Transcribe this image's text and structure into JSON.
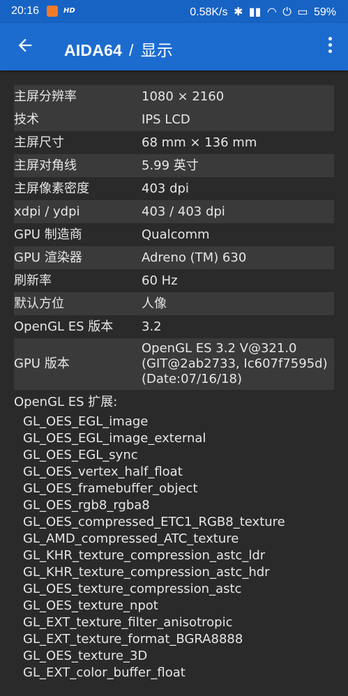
{
  "status": {
    "time": "20:16",
    "hd": "HD",
    "speed": "0.58K/s",
    "battery": "59%"
  },
  "toolbar": {
    "app": "AIDA64",
    "separator": "/",
    "section": "显示"
  },
  "rows": [
    {
      "key": "主屏分辨率",
      "value": "1080 × 2160"
    },
    {
      "key": "技术",
      "value": "IPS LCD"
    },
    {
      "key": "主屏尺寸",
      "value": "68 mm × 136 mm"
    },
    {
      "key": "主屏对角线",
      "value": "5.99 英寸"
    },
    {
      "key": "主屏像素密度",
      "value": "403 dpi"
    },
    {
      "key": "xdpi / ydpi",
      "value": "403 / 403 dpi"
    },
    {
      "key": "GPU 制造商",
      "value": "Qualcomm"
    },
    {
      "key": "GPU 渲染器",
      "value": "Adreno (TM) 630"
    },
    {
      "key": "刷新率",
      "value": "60 Hz"
    },
    {
      "key": "默认方位",
      "value": "人像"
    },
    {
      "key": "OpenGL ES 版本",
      "value": "3.2"
    }
  ],
  "gpu_version": {
    "key": "GPU 版本",
    "lines": [
      "OpenGL ES 3.2 V@321.0",
      "(GIT@2ab2733, Ic607f7595d)",
      "(Date:07/16/18)"
    ]
  },
  "extensions": {
    "title": "OpenGL ES 扩展:",
    "items": [
      "GL_OES_EGL_image",
      "GL_OES_EGL_image_external",
      "GL_OES_EGL_sync",
      "GL_OES_vertex_half_float",
      "GL_OES_framebuffer_object",
      "GL_OES_rgb8_rgba8",
      "GL_OES_compressed_ETC1_RGB8_texture",
      "GL_AMD_compressed_ATC_texture",
      "GL_KHR_texture_compression_astc_ldr",
      "GL_KHR_texture_compression_astc_hdr",
      "GL_OES_texture_compression_astc",
      "GL_OES_texture_npot",
      "GL_EXT_texture_filter_anisotropic",
      "GL_EXT_texture_format_BGRA8888",
      "GL_OES_texture_3D",
      "GL_EXT_color_buffer_float"
    ]
  }
}
